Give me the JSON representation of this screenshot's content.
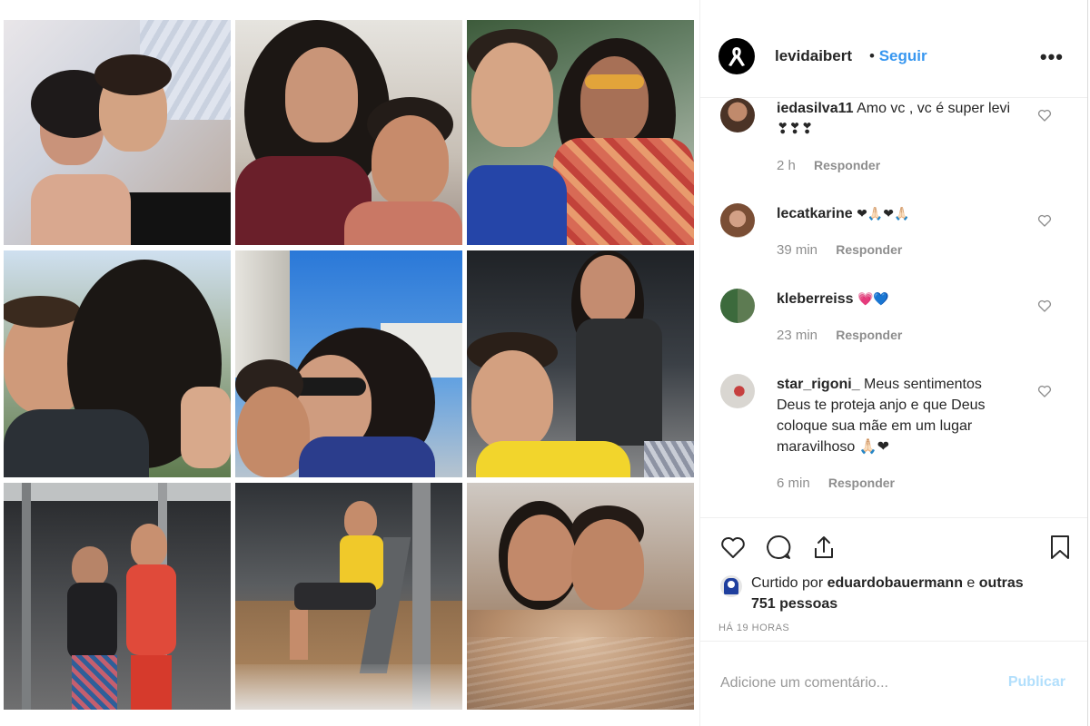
{
  "post": {
    "username": "levidaibert",
    "separator": "•",
    "follow_label": "Seguir",
    "more_label": "•••"
  },
  "comments": [
    {
      "username": "iedasilva11",
      "text": "Amo vc , vc é super levi ❣❣❣",
      "time": "2 h",
      "reply_label": "Responder"
    },
    {
      "username": "lecatkarine",
      "text": "❤🙏🏻❤🙏🏻",
      "time": "39 min",
      "reply_label": "Responder"
    },
    {
      "username": "kleberreiss",
      "text": "💗💙",
      "time": "23 min",
      "reply_label": "Responder"
    },
    {
      "username": "star_rigoni_",
      "text": "Meus sentimentos Deus te proteja anjo e que Deus coloque sua mãe em um lugar maravilhoso 🙏🏻❤",
      "time": "6 min",
      "reply_label": "Responder"
    }
  ],
  "likes": {
    "prefix": "Curtido por",
    "user": "eduardobauermann",
    "mid": "e",
    "others": "outras 751 pessoas"
  },
  "time_ago": "HÁ 19 HORAS",
  "comment_box": {
    "placeholder": "Adicione um comentário...",
    "post_label": "Publicar"
  },
  "colors": {
    "link": "#3897f0",
    "muted": "#8e8e8e",
    "text": "#262626",
    "post_disabled": "#b2dffc"
  },
  "icons": {
    "like": "heart-icon",
    "comment": "comment-bubble-icon",
    "share": "share-icon",
    "save": "bookmark-icon",
    "more": "more-dots-icon"
  },
  "photos": [
    "photo-bed-selfie",
    "photo-home-selfie",
    "photo-sunglasses-selfie",
    "photo-kiss-cheek",
    "photo-outdoor-funny-face",
    "photo-gym-pose",
    "photo-gym-mirror",
    "photo-gym-seated",
    "photo-bath-selfie"
  ]
}
